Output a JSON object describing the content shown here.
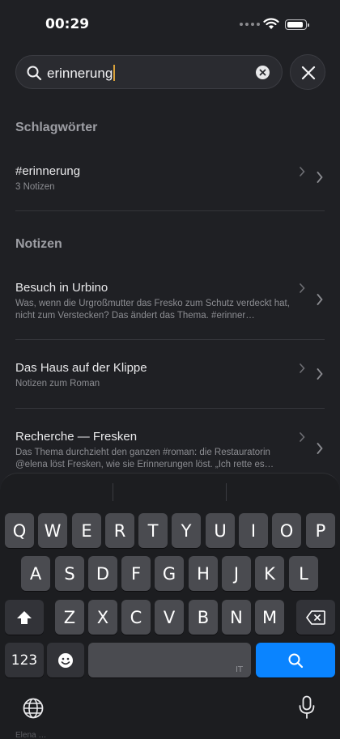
{
  "status_bar": {
    "time": "00:29"
  },
  "search": {
    "query": "erinnerung"
  },
  "sections": {
    "tags_header": "Schlagwörter",
    "notes_header": "Notizen"
  },
  "tags": [
    {
      "title": "#erinnerung",
      "subtitle": "3 Notizen"
    }
  ],
  "notes": [
    {
      "title": "Besuch in Urbino",
      "subtitle": "Was, wenn die Urgroßmutter das Fresko zum Schutz verdeckt hat, nicht zum Verstecken? Das ändert das Thema. #erinner…"
    },
    {
      "title": "Das Haus auf der Klippe",
      "subtitle": "Notizen zum Roman"
    },
    {
      "title": "Recherche — Fresken",
      "subtitle": "Das Thema durchzieht den ganzen #roman: die Restauratorin @elena löst Fresken, wie sie Erinnerungen löst. „Ich rette es…"
    }
  ],
  "keyboard": {
    "row1": [
      "Q",
      "W",
      "E",
      "R",
      "T",
      "Y",
      "U",
      "I",
      "O",
      "P"
    ],
    "row2": [
      "A",
      "S",
      "D",
      "F",
      "G",
      "H",
      "J",
      "K",
      "L"
    ],
    "row3": [
      "Z",
      "X",
      "C",
      "V",
      "B",
      "N",
      "M"
    ],
    "numbers_label": "123",
    "space_lang": "IT",
    "accent_color": "#0a84ff"
  },
  "behind_text": "Elena …"
}
